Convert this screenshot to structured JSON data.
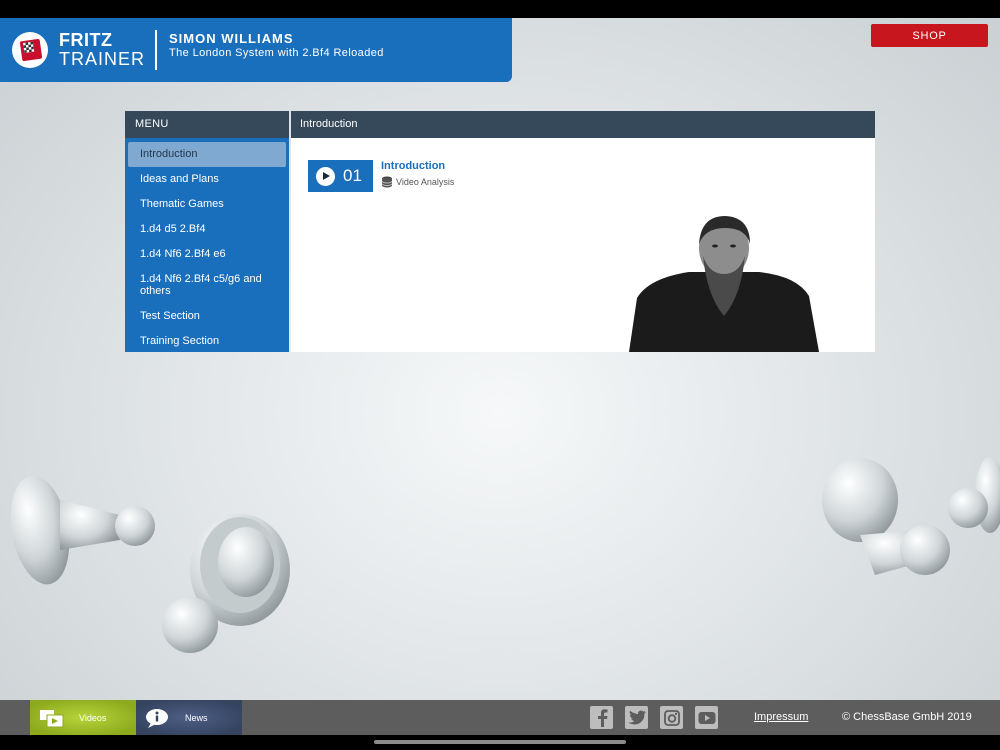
{
  "header": {
    "brand_line1": "FRITZ",
    "brand_line2": "TRAINER",
    "author": "SIMON WILLIAMS",
    "course_title": "The London System with 2.Bf4 Reloaded",
    "shop_label": "SHOP"
  },
  "menu": {
    "title": "MENU",
    "items": [
      {
        "label": "Introduction",
        "active": true
      },
      {
        "label": "Ideas and Plans"
      },
      {
        "label": "Thematic Games"
      },
      {
        "label": "1.d4 d5 2.Bf4"
      },
      {
        "label": "1.d4 Nf6 2.Bf4 e6"
      },
      {
        "label": "1.d4 Nf6 2.Bf4 c5/g6 and others"
      },
      {
        "label": "Test Section"
      },
      {
        "label": "Training Section"
      }
    ]
  },
  "content": {
    "section_title": "Introduction",
    "lessons": [
      {
        "number": "01",
        "title": "Introduction",
        "type": "Video Analysis"
      }
    ]
  },
  "footer": {
    "tabs": [
      {
        "label": "Videos",
        "icon": "video-icon"
      },
      {
        "label": "News",
        "icon": "news-icon"
      }
    ],
    "social": [
      "facebook-icon",
      "twitter-icon",
      "instagram-icon",
      "youtube-icon"
    ],
    "impressum": "Impressum",
    "copyright": "© ChessBase GmbH 2019"
  },
  "colors": {
    "primary_blue": "#1a6fbd",
    "header_dark": "#36495a",
    "shop_red": "#c7161d",
    "videos_green": "#9cbc2a",
    "news_navy": "#3d4d70"
  }
}
